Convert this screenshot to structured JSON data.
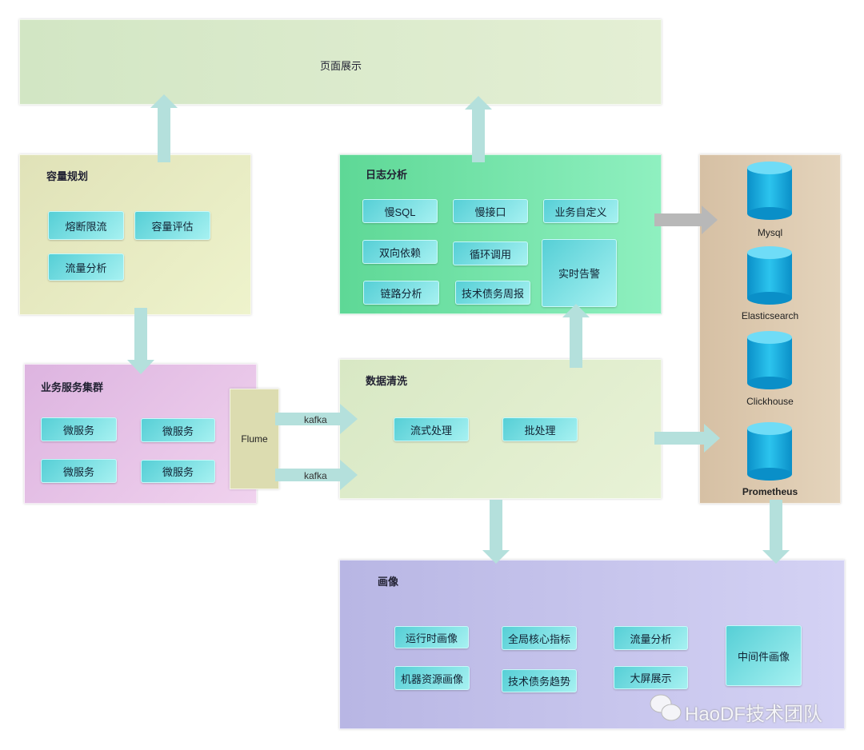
{
  "display": {
    "title": "页面展示"
  },
  "capacity": {
    "title": "容量规划",
    "items": [
      "熔断限流",
      "容量评估",
      "流量分析"
    ]
  },
  "log": {
    "title": "日志分析",
    "items": [
      "慢SQL",
      "慢接口",
      "业务自定义",
      "双向依赖",
      "循环调用",
      "实时告警",
      "链路分析",
      "技术债务周报"
    ]
  },
  "cluster": {
    "title": "业务服务集群",
    "items": [
      "微服务",
      "微服务",
      "微服务",
      "微服务"
    ]
  },
  "flume": {
    "label": "Flume"
  },
  "kafka": [
    "kafka",
    "kafka"
  ],
  "clean": {
    "title": "数据清洗",
    "items": [
      "流式处理",
      "批处理"
    ]
  },
  "storage": [
    "Mysql",
    "Elasticsearch",
    "Clickhouse",
    "Prometheus"
  ],
  "profile": {
    "title": "画像",
    "items": [
      "运行时画像",
      "全局核心指标",
      "流量分析",
      "机器资源画像",
      "技术债务趋势",
      "大屏展示",
      "中间件画像"
    ]
  },
  "watermark": "HaoDF技术团队",
  "colors": {
    "chip": "#5fd4d8",
    "log": "#6ee0a0",
    "profile": "#c4c0ec",
    "cluster": "#e8c0e8",
    "storage": "#d8c4a8"
  }
}
